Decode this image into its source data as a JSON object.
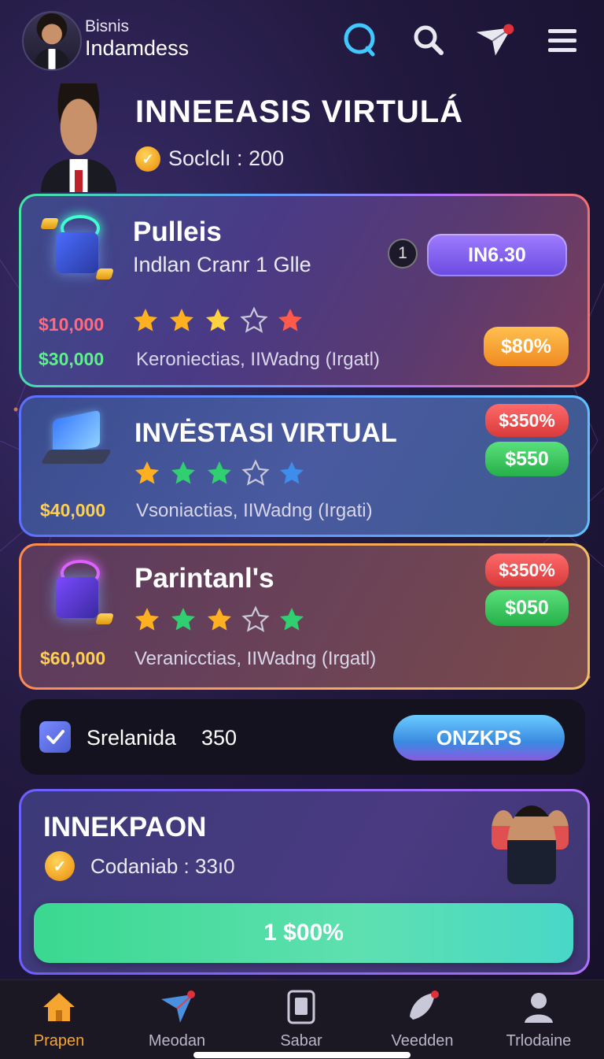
{
  "header": {
    "brand_small": "Bisnis",
    "brand_big": "Indamdess",
    "icons": [
      "circle-icon",
      "search-icon",
      "paper-plane-icon",
      "menu-icon"
    ],
    "notification_dot_color": "#e0303a"
  },
  "hero": {
    "title": "INNEEASIS VIRTULÁ",
    "coins_label": "Soclclı",
    "coins_sep": ":",
    "coins_value": "200"
  },
  "cards": [
    {
      "title": "Pulleis",
      "subtitle": "Indlan Cranr 1 Glle",
      "badge_number": "1",
      "primary_button": "IN6.30",
      "price_1": "$10,000",
      "price_2": "$30,000",
      "description": "Keroniectias, IIWadng (Irgatl)",
      "percent_button": "$80%",
      "stars": [
        "gold",
        "gold",
        "gold",
        "outline",
        "red"
      ]
    },
    {
      "title": "INVĖSTASI VIRTUAL",
      "price": "$40,000",
      "description": "Vsoniactias, IIWadng (Irgati)",
      "red_pill": "$350%",
      "green_pill": "$550",
      "stars": [
        "gold",
        "green",
        "green",
        "outline",
        "blue"
      ]
    },
    {
      "title": "Parintanl's",
      "price": "$60,000",
      "description": "Veranicctias, IIWadng (Irgatl)",
      "red_pill": "$350%",
      "green_pill": "$050",
      "stars": [
        "gold",
        "green",
        "gold",
        "outline",
        "green"
      ]
    }
  ],
  "check_row": {
    "label": "Srelanida",
    "value": "350",
    "button": "ONZKPS",
    "checked": true
  },
  "invest": {
    "title": "INNEKPAON",
    "coins_label": "Codaniab",
    "coins_sep": ":",
    "coins_value": "33ı0",
    "cta": "1 $00%"
  },
  "nav": {
    "items": [
      {
        "label": "Prapen",
        "icon": "home-icon",
        "active": true
      },
      {
        "label": "Meodan",
        "icon": "map-icon",
        "active": false
      },
      {
        "label": "Sabar",
        "icon": "document-icon",
        "active": false
      },
      {
        "label": "Veedden",
        "icon": "rocket-icon",
        "active": false
      },
      {
        "label": "Trlodaine",
        "icon": "profile-icon",
        "active": false
      }
    ],
    "active_color": "#f6a530"
  }
}
